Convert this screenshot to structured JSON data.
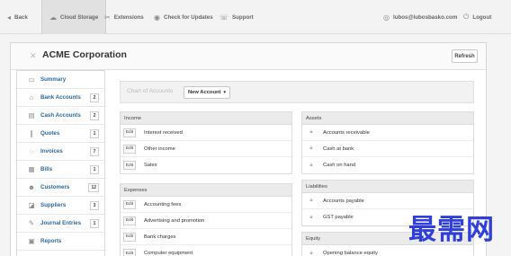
{
  "topnav": {
    "back": "Back",
    "cloud_storage": "Cloud Storage",
    "extensions": "Extensions",
    "check_updates": "Check for Updates",
    "support": "Support",
    "user_email": "lubos@lubosbasko.com",
    "logout": "Logout"
  },
  "page": {
    "title": "ACME Corporation",
    "refresh": "Refresh"
  },
  "sidebar": {
    "items": [
      {
        "label": "Summary",
        "badge": null
      },
      {
        "label": "Bank Accounts",
        "badge": "2"
      },
      {
        "label": "Cash Accounts",
        "badge": "2"
      },
      {
        "label": "Quotes",
        "badge": "1"
      },
      {
        "label": "Invoices",
        "badge": "7"
      },
      {
        "label": "Bills",
        "badge": "1"
      },
      {
        "label": "Customers",
        "badge": "12"
      },
      {
        "label": "Suppliers",
        "badge": "3"
      },
      {
        "label": "Journal Entries",
        "badge": "1"
      },
      {
        "label": "Reports",
        "badge": null
      }
    ]
  },
  "chart_of_accounts": {
    "label": "Chart of Accounts",
    "new_account": "New Account"
  },
  "edit_label": "Edit",
  "groups": {
    "income": {
      "title": "Income",
      "accounts": [
        "Interest received",
        "Other income",
        "Sales"
      ]
    },
    "expenses": {
      "title": "Expenses",
      "accounts": [
        "Accounting fees",
        "Advertising and promotion",
        "Bank charges",
        "Computer equipment"
      ]
    },
    "assets": {
      "title": "Assets",
      "accounts": [
        "Accounts receivable",
        "Cash at bank",
        "Cash on hand"
      ]
    },
    "liabilities": {
      "title": "Liabilities",
      "accounts": [
        "Accounts payable",
        "GST payable"
      ]
    },
    "equity": {
      "title": "Equity",
      "accounts": [
        "Opening balance equity"
      ]
    }
  },
  "watermark": "最需网",
  "colors": {
    "link": "#2b6a99",
    "watermark": "#2f3fd8"
  }
}
